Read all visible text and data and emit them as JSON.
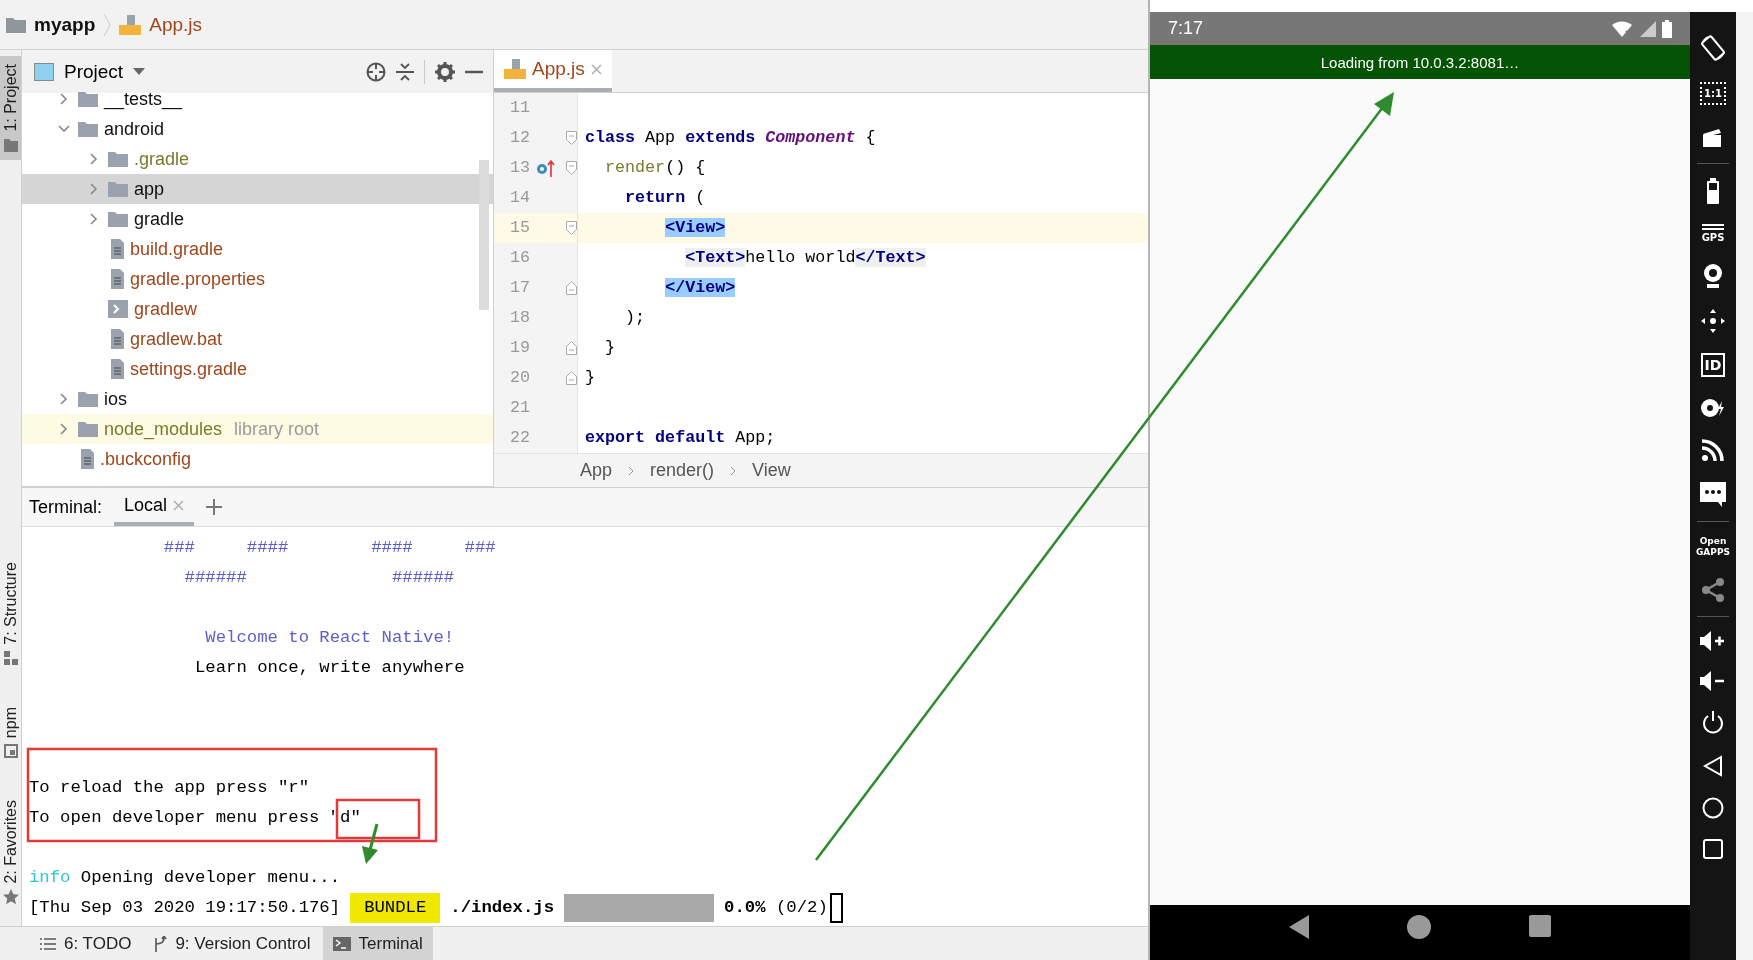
{
  "nav_bar": {
    "project": "myapp",
    "file": "App.js"
  },
  "tool_strip_top": [
    {
      "label": "1: Project",
      "kind": "project",
      "selected": true
    }
  ],
  "tool_strip_bottom": [
    {
      "label": "7: Structure",
      "kind": "structure",
      "selected": false
    },
    {
      "label": "npm",
      "kind": "npm",
      "selected": false
    },
    {
      "label": "2: Favorites",
      "kind": "favorites",
      "selected": false
    }
  ],
  "project_panel": {
    "title": "Project",
    "tree": [
      {
        "label": "__tests__",
        "kind": "folder",
        "color": "#111111",
        "expanded": false,
        "selected": false
      },
      {
        "label": "android",
        "kind": "folder",
        "color": "#111111",
        "expanded": true,
        "selected": false,
        "children": [
          {
            "label": ".gradle",
            "kind": "folder",
            "color": "#787b2e",
            "expanded": false,
            "selected": false
          },
          {
            "label": "app",
            "kind": "folder",
            "color": "#111111",
            "expanded": false,
            "selected": true
          },
          {
            "label": "gradle",
            "kind": "folder",
            "color": "#111111",
            "expanded": false,
            "selected": false
          },
          {
            "label": "build.gradle",
            "kind": "file",
            "color": "#a0461c",
            "selected": false
          },
          {
            "label": "gradle.properties",
            "kind": "file",
            "color": "#a0461c",
            "selected": false
          },
          {
            "label": "gradlew",
            "kind": "script",
            "color": "#a0461c",
            "selected": false
          },
          {
            "label": "gradlew.bat",
            "kind": "file",
            "color": "#a0461c",
            "selected": false
          },
          {
            "label": "settings.gradle",
            "kind": "file",
            "color": "#a0461c",
            "selected": false
          }
        ]
      },
      {
        "label": "ios",
        "kind": "folder",
        "color": "#111111",
        "expanded": false,
        "selected": false
      },
      {
        "label": "node_modules",
        "kind": "library",
        "color": "#787b2e",
        "expanded": false,
        "selected": false,
        "note": "library root"
      },
      {
        "label": ".buckconfig",
        "kind": "file",
        "color": "#a0461c",
        "selected": false
      }
    ]
  },
  "editor": {
    "tab": {
      "label": "App.js",
      "selected": true
    },
    "lines": [
      {
        "number": "11",
        "current": false,
        "fold_start": false,
        "fold_end": false,
        "override_marker": false
      },
      {
        "number": "12",
        "current": false,
        "fold_start": true,
        "fold_end": false,
        "override_marker": false,
        "tokens": [
          {
            "text": "class ",
            "kind": "keyword"
          },
          {
            "text": "App ",
            "kind": "plain"
          },
          {
            "text": "extends ",
            "kind": "keyword"
          },
          {
            "text": "Component",
            "kind": "type"
          },
          {
            "text": " {",
            "kind": "plain"
          }
        ]
      },
      {
        "number": "13",
        "current": false,
        "fold_start": true,
        "fold_end": false,
        "override_marker": true,
        "tokens": [
          {
            "text": "  render",
            "kind": "method"
          },
          {
            "text": "() {",
            "kind": "plain"
          }
        ]
      },
      {
        "number": "14",
        "current": false,
        "fold_start": false,
        "fold_end": false,
        "override_marker": false,
        "tokens": [
          {
            "text": "    return",
            "kind": "keyword"
          },
          {
            "text": " (",
            "kind": "plain"
          }
        ]
      },
      {
        "number": "15",
        "current": true,
        "fold_start": true,
        "fold_end": false,
        "override_marker": false,
        "tokens": [
          {
            "text": "        <View>",
            "kind": "tag-match"
          }
        ]
      },
      {
        "number": "16",
        "current": false,
        "fold_start": false,
        "fold_end": false,
        "override_marker": false,
        "tokens": [
          {
            "text": "          <Text>",
            "kind": "tag"
          },
          {
            "text": "hello world",
            "kind": "plain"
          },
          {
            "text": "</Text>",
            "kind": "tag"
          }
        ]
      },
      {
        "number": "17",
        "current": false,
        "fold_start": false,
        "fold_end": true,
        "override_marker": false,
        "tokens": [
          {
            "text": "        </View>",
            "kind": "tag-match"
          }
        ]
      },
      {
        "number": "18",
        "current": false,
        "fold_start": false,
        "fold_end": false,
        "override_marker": false,
        "tokens": [
          {
            "text": "    );",
            "kind": "plain"
          }
        ]
      },
      {
        "number": "19",
        "current": false,
        "fold_start": false,
        "fold_end": true,
        "override_marker": false,
        "tokens": [
          {
            "text": "  }",
            "kind": "plain"
          }
        ]
      },
      {
        "number": "20",
        "current": false,
        "fold_start": false,
        "fold_end": true,
        "override_marker": false,
        "tokens": [
          {
            "text": "}",
            "kind": "plain"
          }
        ]
      },
      {
        "number": "21",
        "current": false,
        "fold_start": false,
        "fold_end": false,
        "override_marker": false
      },
      {
        "number": "22",
        "current": false,
        "fold_start": false,
        "fold_end": false,
        "override_marker": false,
        "tokens": [
          {
            "text": "export default",
            "kind": "keyword"
          },
          {
            "text": " App;",
            "kind": "plain"
          }
        ]
      }
    ],
    "breadcrumb": [
      "App",
      "render()",
      "View"
    ]
  },
  "terminal": {
    "label": "Terminal:",
    "tabs": [
      {
        "label": "Local",
        "selected": true
      }
    ],
    "lines": [
      {
        "kind": "art",
        "text": "             ###     ####        ####     ###"
      },
      {
        "kind": "art",
        "text": "               ######              ######"
      },
      {
        "kind": "blank"
      },
      {
        "kind": "welcome",
        "text": "                 Welcome to React Native!"
      },
      {
        "kind": "plain",
        "text": "                Learn once, write anywhere"
      },
      {
        "kind": "blank"
      },
      {
        "kind": "blank"
      },
      {
        "kind": "blank"
      },
      {
        "kind": "plain",
        "text": "To reload the app press \"r\""
      },
      {
        "kind": "plain",
        "text": "To open developer menu press \"d\""
      },
      {
        "kind": "blank"
      },
      {
        "kind": "log",
        "tag": "info",
        "text": " Opening developer menu..."
      },
      {
        "kind": "bundle",
        "time": "[Thu Sep 03 2020 19:17:50.176]",
        "badge": "BUNDLE",
        "file": "./index.js",
        "level": 0,
        "percent": "0.0%",
        "count": "(0/2)"
      }
    ]
  },
  "bottom_bar": [
    {
      "label": "6: TODO",
      "kind": "todo",
      "selected": false
    },
    {
      "label": "9: Version Control",
      "kind": "vcs",
      "selected": false
    },
    {
      "label": "Terminal",
      "kind": "terminal",
      "selected": true
    }
  ],
  "emulator": {
    "time": "7:17",
    "banner": "Loading from 10.0.3.2:8081…",
    "toolbar": [
      {
        "kind": "rotate"
      },
      {
        "kind": "scale",
        "label": "1:1"
      },
      {
        "kind": "capture"
      },
      {
        "kind": "divider"
      },
      {
        "kind": "battery"
      },
      {
        "kind": "gps",
        "label": "GPS"
      },
      {
        "kind": "camera"
      },
      {
        "kind": "dpad"
      },
      {
        "kind": "id",
        "label": "ID"
      },
      {
        "kind": "disk"
      },
      {
        "kind": "feed"
      },
      {
        "kind": "sms"
      },
      {
        "kind": "divider"
      },
      {
        "kind": "gapps",
        "label": "Open GAPPS"
      },
      {
        "kind": "share"
      },
      {
        "kind": "divider"
      },
      {
        "kind": "volume-up"
      },
      {
        "kind": "volume-down"
      },
      {
        "kind": "power"
      },
      {
        "kind": "back"
      },
      {
        "kind": "home"
      },
      {
        "kind": "recents"
      }
    ]
  }
}
